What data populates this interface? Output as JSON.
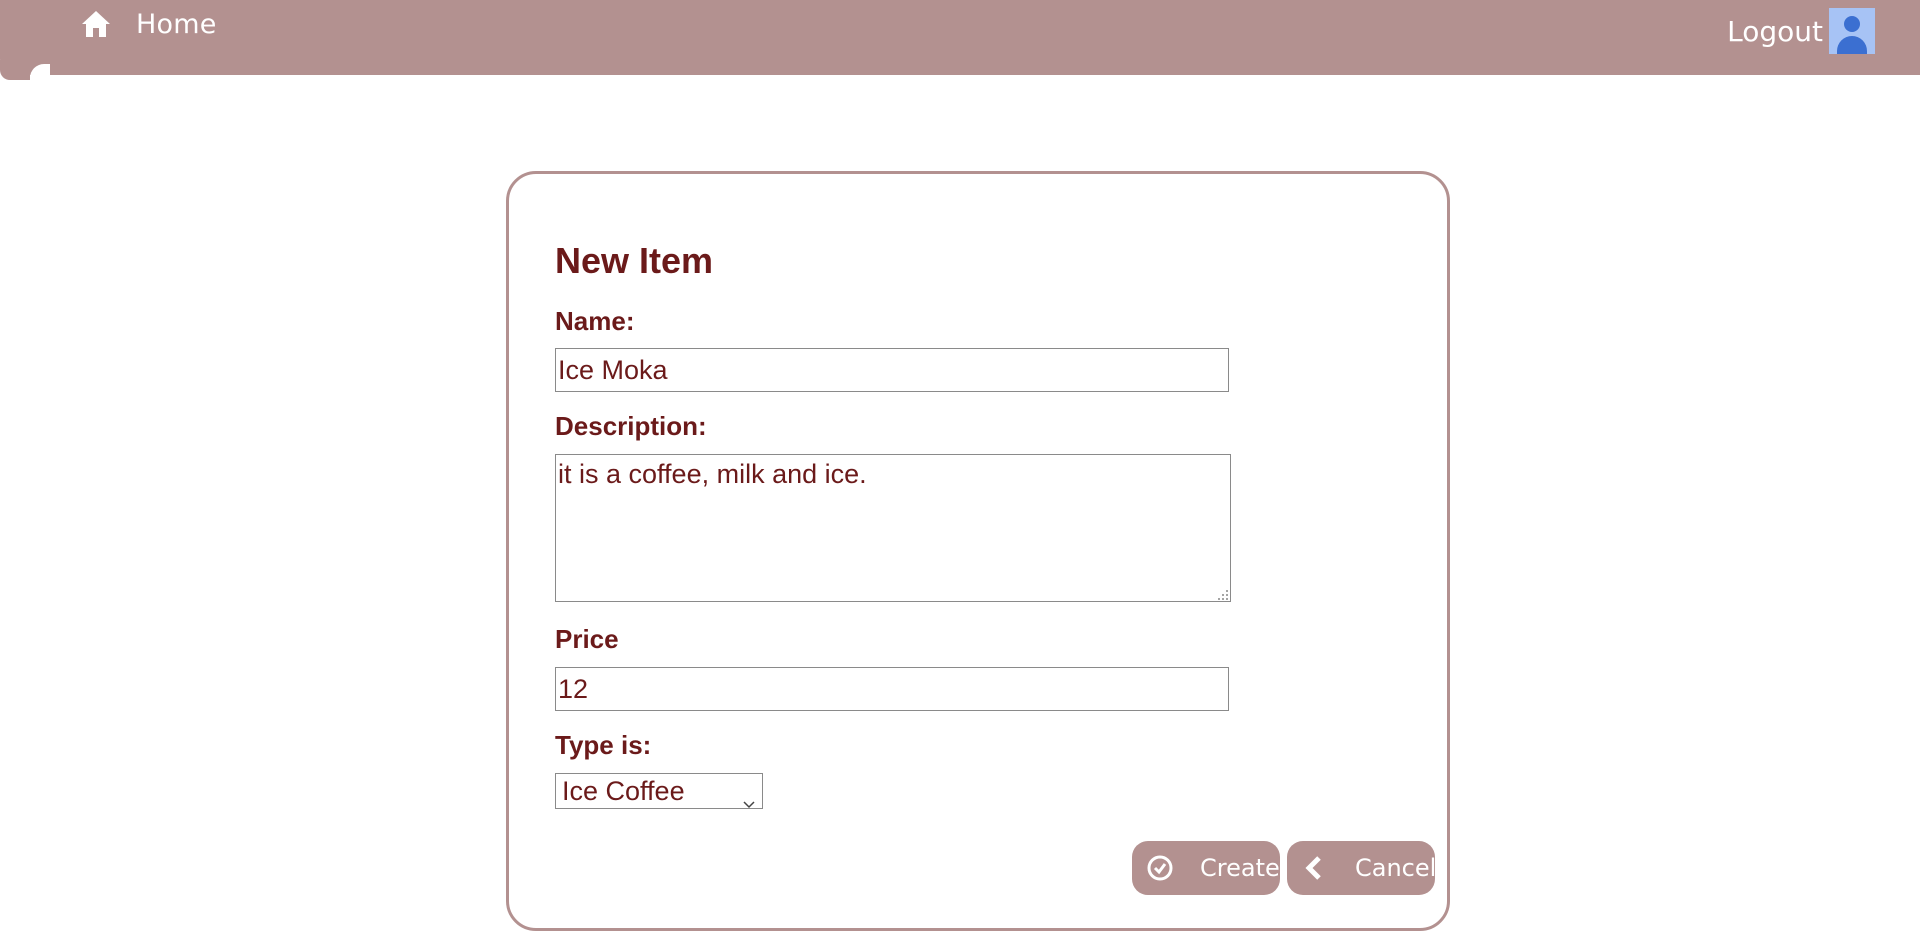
{
  "navbar": {
    "home_label": "Home",
    "home_icon": "home-icon",
    "logout_label": "Logout",
    "avatar_icon": "user-avatar-icon",
    "background_color": "#b39190"
  },
  "form": {
    "title": "New Item",
    "name_label": "Name:",
    "name_value": "Ice Moka",
    "description_label": "Description:",
    "description_value": "it is a coffee, milk and ice.",
    "price_label": "Price",
    "price_value": "12",
    "type_label": "Type is:",
    "type_selected": "Ice Coffee",
    "text_color": "#6b1a1a",
    "border_color": "#b39190"
  },
  "actions": {
    "create_label": "Create",
    "create_icon": "check-circle-icon",
    "cancel_label": "Cancel",
    "cancel_icon": "chevron-left-icon"
  }
}
